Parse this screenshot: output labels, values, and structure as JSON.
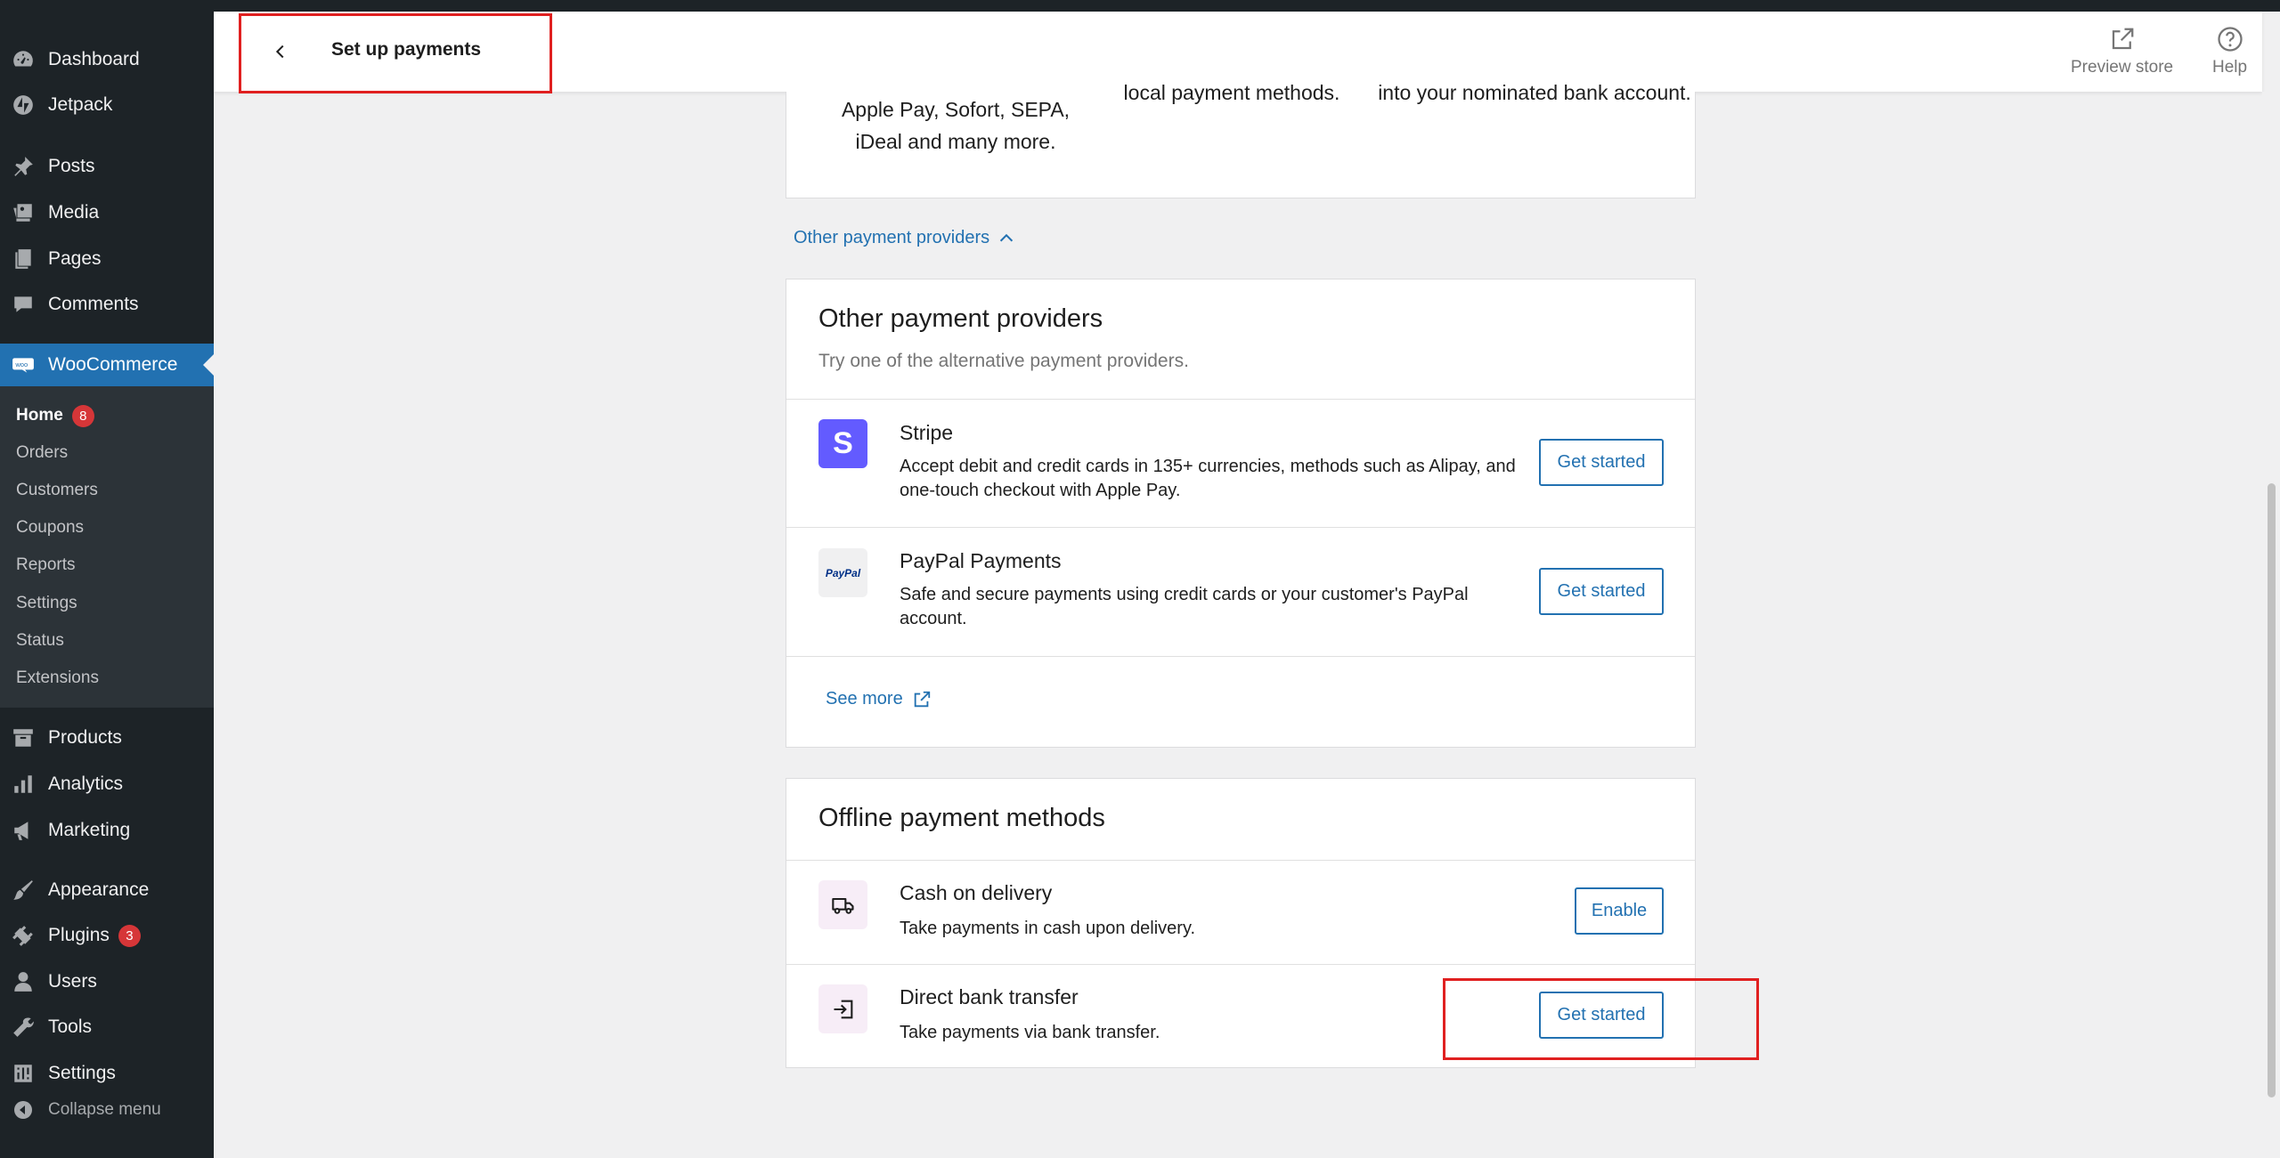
{
  "header": {
    "title": "Set up payments",
    "preview_store": "Preview store",
    "help": "Help"
  },
  "sidebar": {
    "items": [
      {
        "label": "Dashboard",
        "icon": "dashboard-icon"
      },
      {
        "label": "Jetpack",
        "icon": "jetpack-icon"
      },
      {
        "label": "Posts",
        "icon": "pin-icon"
      },
      {
        "label": "Media",
        "icon": "media-icon"
      },
      {
        "label": "Pages",
        "icon": "pages-icon"
      },
      {
        "label": "Comments",
        "icon": "comment-icon"
      },
      {
        "label": "WooCommerce",
        "icon": "woo-icon"
      },
      {
        "label": "Products",
        "icon": "archive-icon"
      },
      {
        "label": "Analytics",
        "icon": "bar-chart-icon"
      },
      {
        "label": "Marketing",
        "icon": "megaphone-icon"
      },
      {
        "label": "Appearance",
        "icon": "brush-icon"
      },
      {
        "label": "Plugins",
        "icon": "plug-icon",
        "badge": "3"
      },
      {
        "label": "Users",
        "icon": "user-icon"
      },
      {
        "label": "Tools",
        "icon": "wrench-icon"
      },
      {
        "label": "Settings",
        "icon": "sliders-icon"
      }
    ],
    "woo_submenu": [
      {
        "label": "Home",
        "badge": "8"
      },
      {
        "label": "Orders"
      },
      {
        "label": "Customers"
      },
      {
        "label": "Coupons"
      },
      {
        "label": "Reports"
      },
      {
        "label": "Settings"
      },
      {
        "label": "Status"
      },
      {
        "label": "Extensions"
      }
    ],
    "collapse": "Collapse menu"
  },
  "features": {
    "col1": "Apple Pay, Sofort, SEPA, iDeal and many more.",
    "col2": "local payment methods.",
    "col3": "into your nominated bank account."
  },
  "toggle_link": "Other payment providers",
  "other_providers": {
    "title": "Other payment providers",
    "subtitle": "Try one of the alternative payment providers.",
    "providers": [
      {
        "name": "Stripe",
        "description": "Accept debit and credit cards in 135+ currencies, methods such as Alipay, and one-touch checkout with Apple Pay.",
        "button": "Get started",
        "logo": "S"
      },
      {
        "name": "PayPal Payments",
        "description": "Safe and secure payments using credit cards or your customer's PayPal account.",
        "button": "Get started",
        "logo": "PayPal"
      }
    ],
    "see_more": "See more"
  },
  "offline": {
    "title": "Offline payment methods",
    "methods": [
      {
        "name": "Cash on delivery",
        "description": "Take payments in cash upon delivery.",
        "button": "Enable",
        "icon": "truck-icon"
      },
      {
        "name": "Direct bank transfer",
        "description": "Take payments via bank transfer.",
        "button": "Get started",
        "icon": "bank-transfer-icon"
      }
    ]
  },
  "colors": {
    "admin_bg": "#1d2327",
    "accent": "#2271b1",
    "badge": "#d63638",
    "highlight": "#e02020",
    "stripe_purple": "#635bff"
  }
}
